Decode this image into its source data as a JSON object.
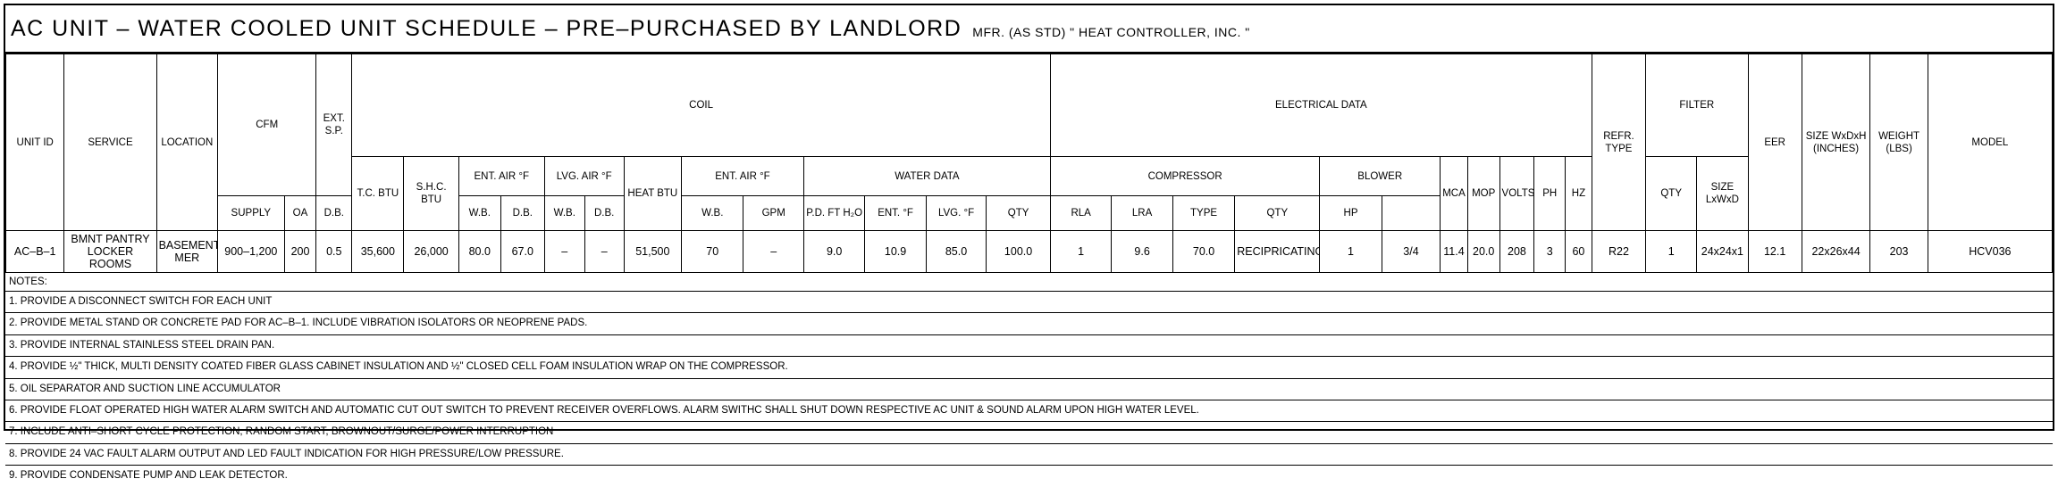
{
  "title": {
    "main": "AC UNIT – WATER COOLED UNIT SCHEDULE – PRE–PURCHASED BY LANDLORD",
    "sub": "MFR. (AS STD) \" HEAT CONTROLLER, INC. \""
  },
  "header": {
    "unit_id": "UNIT ID",
    "service": "SERVICE",
    "location": "LOCATION",
    "cfm": "CFM",
    "supply": "SUPPLY",
    "oa": "OA",
    "ext_sp": "EXT. S.P.",
    "coil": "COIL",
    "tc_btu": "T.C. BTU",
    "shc_btu": "S.H.C. BTU",
    "ent_air": "ENT. AIR °F",
    "lvg_air": "LVG. AIR °F",
    "db": "D.B.",
    "wb": "W.B.",
    "heat_btu": "HEAT BTU",
    "ent_air_2": "ENT. AIR °F",
    "water_data": "WATER DATA",
    "gpm": "GPM",
    "pd_ft": "P.D. FT H₂O",
    "ent_f": "ENT. °F",
    "lvg_f": "LVG. °F",
    "electrical": "ELECTRICAL DATA",
    "compressor": "COMPRESSOR",
    "qty": "QTY",
    "rla": "RLA",
    "lra": "LRA",
    "type": "TYPE",
    "blower": "BLOWER",
    "hp": "HP",
    "mca": "MCA",
    "mop": "MOP",
    "volts": "VOLTS",
    "ph": "PH",
    "hz": "HZ",
    "refr_type": "REFR. TYPE",
    "filter": "FILTER",
    "filter_qty": "QTY",
    "filter_size": "SIZE LxWxD",
    "eer": "EER",
    "size": "SIZE WxDxH (INCHES)",
    "weight": "WEIGHT (LBS)",
    "model": "MODEL"
  },
  "row": {
    "unit_id": "AC–B–1",
    "service": "BMNT PANTRY LOCKER ROOMS",
    "location": "BASEMENT MER",
    "supply": "900–1,200",
    "oa": "200",
    "ext_sp": "0.5",
    "tc_btu": "35,600",
    "shc_btu": "26,000",
    "ent_db": "80.0",
    "ent_wb": "67.0",
    "lvg_db": "–",
    "lvg_wb": "–",
    "heat_btu": "51,500",
    "ent2_db": "70",
    "ent2_wb": "–",
    "gpm": "9.0",
    "pd_ft": "10.9",
    "ent_f": "85.0",
    "lvg_f": "100.0",
    "comp_qty": "1",
    "rla": "9.6",
    "lra": "70.0",
    "type": "RECIPRICATING",
    "blower_qty": "1",
    "hp": "3/4",
    "mca": "11.4",
    "mop": "20.0",
    "volts": "208",
    "ph": "3",
    "hz": "60",
    "refr_type": "R22",
    "filter_qty": "1",
    "filter_size": "24x24x1",
    "eer": "12.1",
    "size": "22x26x44",
    "weight": "203",
    "model": "HCV036"
  },
  "notes": {
    "heading": "NOTES:",
    "items": [
      "1. PROVIDE A DISCONNECT SWITCH FOR EACH UNIT",
      "2. PROVIDE METAL STAND OR CONCRETE PAD FOR AC–B–1. INCLUDE VIBRATION ISOLATORS OR NEOPRENE PADS.",
      "3. PROVIDE INTERNAL STAINLESS STEEL DRAIN PAN.",
      "4. PROVIDE ½\" THICK, MULTI DENSITY COATED FIBER GLASS CABINET INSULATION AND ½\" CLOSED CELL FOAM INSULATION WRAP ON THE COMPRESSOR.",
      "5. OIL SEPARATOR AND SUCTION LINE ACCUMULATOR",
      "6. PROVIDE FLOAT OPERATED HIGH WATER ALARM SWITCH AND AUTOMATIC CUT OUT SWITCH TO PREVENT RECEIVER OVERFLOWS. ALARM SWITHC SHALL SHUT DOWN RESPECTIVE AC UNIT & SOUND ALARM UPON HIGH WATER LEVEL.",
      "7. INCLUDE ANTI–SHORT CYCLE PROTECTION, RANDOM START, BROWNOUT/SURGE/POWER INTERRUPTION",
      "8. PROVIDE 24 VAC FAULT ALARM OUTPUT AND LED FAULT INDICATION FOR HIGH PRESSURE/LOW PRESSURE.",
      "9. PROVIDE CONDENSATE PUMP AND LEAK DETECTOR."
    ]
  }
}
